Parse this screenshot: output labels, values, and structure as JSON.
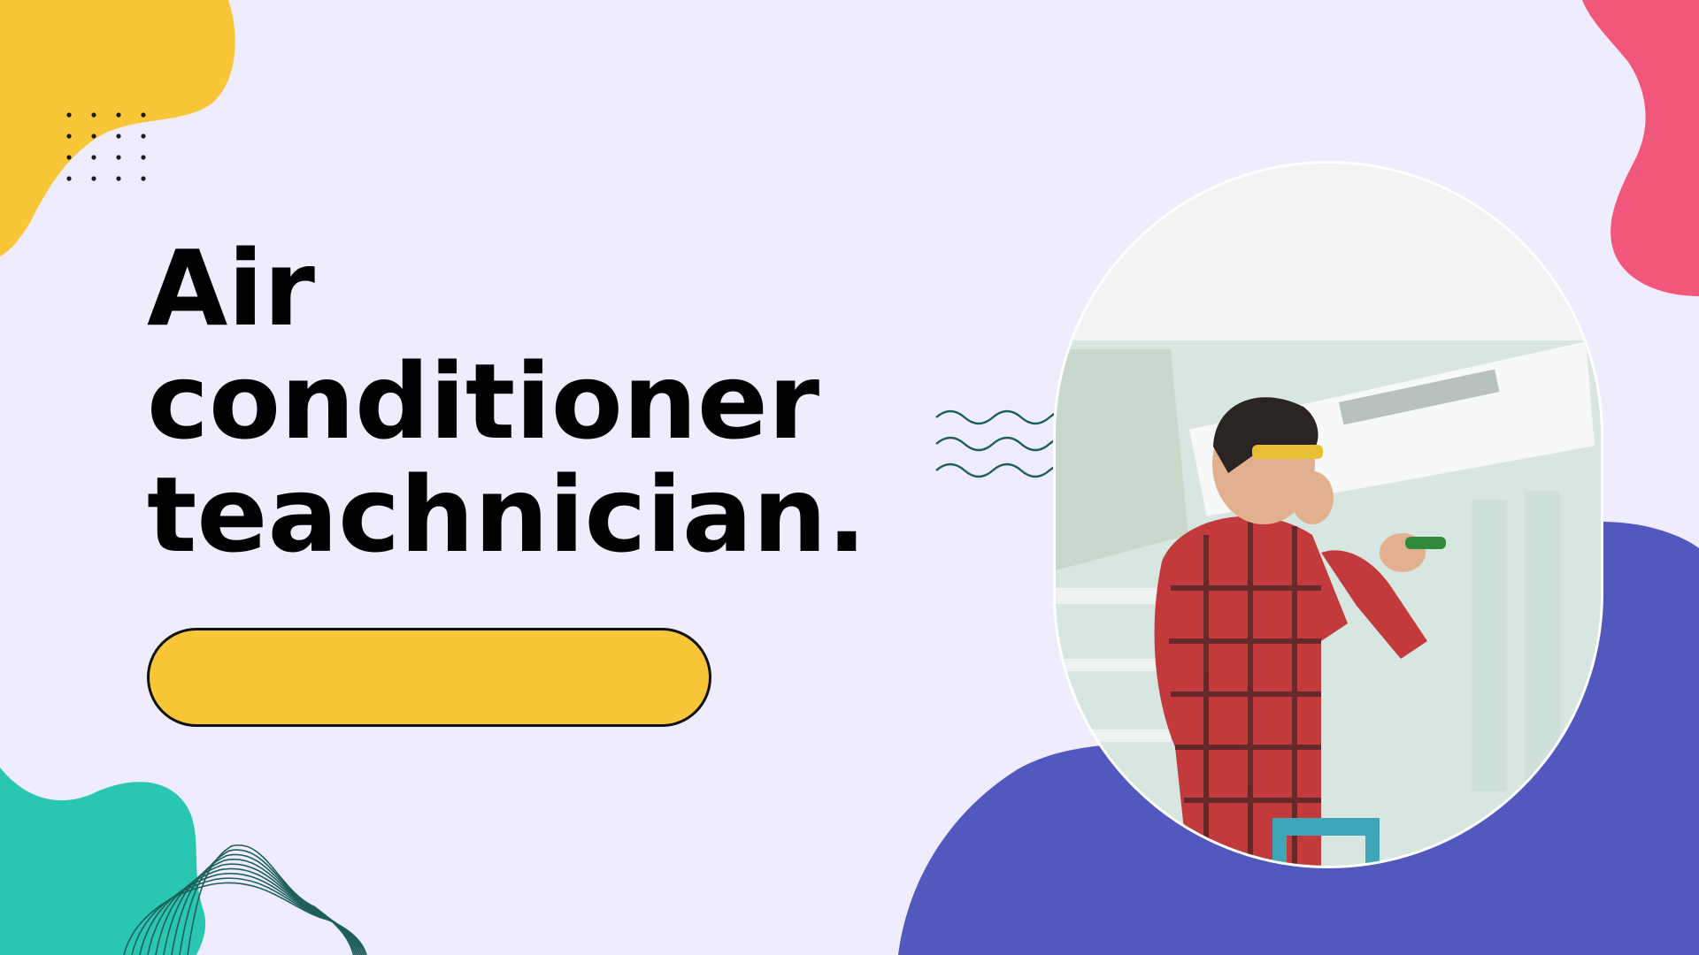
{
  "slide": {
    "title_lines": [
      "Air",
      "conditioner",
      "teachnician."
    ]
  },
  "colors": {
    "background": "#efedfd",
    "yellow": "#f9c638",
    "pink": "#f0577a",
    "teal": "#29c7b1",
    "purple": "#5258be",
    "dark_teal": "#1f5f5a",
    "text": "#000000"
  },
  "photo": {
    "subject": "technician-repairing-air-conditioner"
  }
}
